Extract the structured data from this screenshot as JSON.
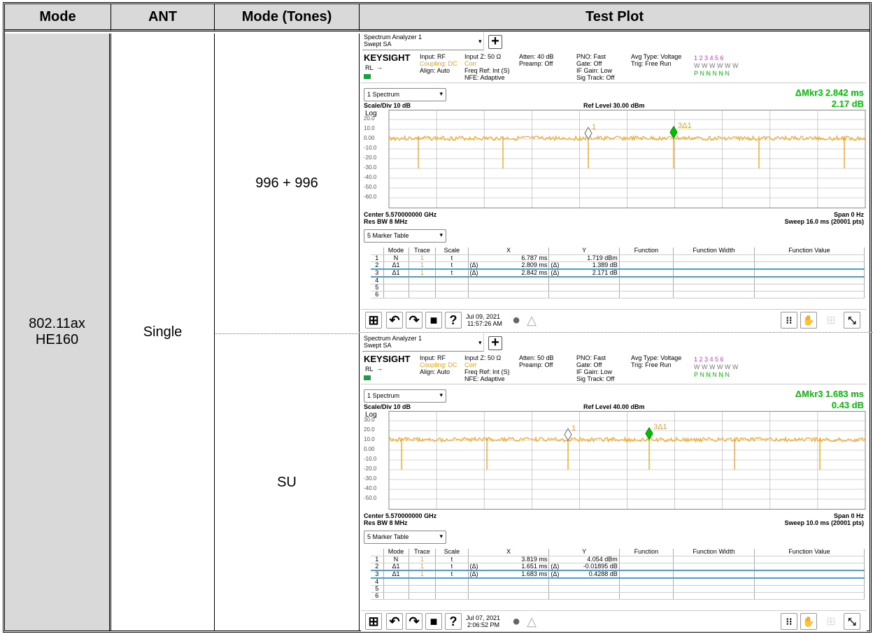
{
  "table": {
    "headers": [
      "Mode",
      "ANT",
      "Mode (Tones)",
      "Test Plot"
    ],
    "mode": "802.11ax HE160",
    "ant": "Single",
    "tones": [
      "996 + 996",
      "SU"
    ]
  },
  "plots": [
    {
      "title1": "Spectrum Analyzer 1",
      "title2": "Swept SA",
      "brand": "KEYSIGHT",
      "rl": "RL",
      "col1": [
        "Input: RF",
        "Coupling: DC",
        "Align: Auto"
      ],
      "col2": [
        "Input Z: 50 Ω",
        "Corr",
        "Freq Ref: Int (S)",
        "NFE: Adaptive"
      ],
      "col3": [
        "Atten: 40 dB",
        "Preamp: Off"
      ],
      "col4": [
        "PNO: Fast",
        "Gate: Off",
        "IF Gain: Low",
        "Sig Track: Off"
      ],
      "col5": [
        "Avg Type: Voltage",
        "Trig: Free Run"
      ],
      "trace_nums": "1 2 3 4 5 6",
      "trace_w": "W W W W W W",
      "trace_p": "P N N N N N",
      "view": "1 Spectrum",
      "mkr_label": "ΔMkr3  2.842 ms",
      "mkr_val": "2.17 dB",
      "scale": "Scale/Div 10 dB",
      "ref": "Ref Level 30.00 dBm",
      "log": "Log",
      "yticks": [
        "20.0",
        "10.0",
        "0.00",
        "-10.0",
        "-20.0",
        "-30.0",
        "-40.0",
        "-50.0",
        "-60.0"
      ],
      "center": "Center 5.570000000 GHz",
      "span": "Span 0 Hz",
      "rbw": "Res BW 8 MHz",
      "sweep": "Sweep 16.0 ms (20001 pts)",
      "marker_view": "5 Marker Table",
      "marker_headers": [
        "",
        "Mode",
        "Trace",
        "Scale",
        "X",
        "Y",
        "Function",
        "Function Width",
        "Function Value"
      ],
      "markers": [
        [
          "1",
          "N",
          "1",
          "t",
          "",
          "6.787 ms",
          "",
          "1.719 dBm"
        ],
        [
          "2",
          "Δ1",
          "1",
          "t",
          "(Δ)",
          "2.809 ms",
          "(Δ)",
          "1.389 dB"
        ],
        [
          "3",
          "Δ1",
          "1",
          "t",
          "(Δ)",
          "2.842 ms",
          "(Δ)",
          "2.171 dB"
        ],
        [
          "4",
          "",
          "",
          "",
          "",
          "",
          "",
          ""
        ],
        [
          "5",
          "",
          "",
          "",
          "",
          "",
          "",
          ""
        ],
        [
          "6",
          "",
          "",
          "",
          "",
          "",
          "",
          ""
        ]
      ],
      "mk1": "1",
      "mk3": "3Δ1",
      "date": "Jul 09, 2021",
      "time": "11:57:26 AM"
    },
    {
      "title1": "Spectrum Analyzer 1",
      "title2": "Swept SA",
      "brand": "KEYSIGHT",
      "rl": "RL",
      "col1": [
        "Input: RF",
        "Coupling: DC",
        "Align: Auto"
      ],
      "col2": [
        "Input Z: 50 Ω",
        "Corr",
        "Freq Ref: Int (S)",
        "NFE: Adaptive"
      ],
      "col3": [
        "Atten: 50 dB",
        "Preamp: Off"
      ],
      "col4": [
        "PNO: Fast",
        "Gate: Off",
        "IF Gain: Low",
        "Sig Track: Off"
      ],
      "col5": [
        "Avg Type: Voltage",
        "Trig: Free Run"
      ],
      "trace_nums": "1 2 3 4 5 6",
      "trace_w": "W W W W W W",
      "trace_p": "P N N N N N",
      "view": "1 Spectrum",
      "mkr_label": "ΔMkr3  1.683 ms",
      "mkr_val": "0.43 dB",
      "scale": "Scale/Div 10 dB",
      "ref": "Ref Level 40.00 dBm",
      "log": "Log",
      "yticks": [
        "30.0",
        "20.0",
        "10.0",
        "0.00",
        "-10.0",
        "-20.0",
        "-30.0",
        "-40.0",
        "-50.0"
      ],
      "center": "Center 5.570000000 GHz",
      "span": "Span 0 Hz",
      "rbw": "Res BW 8 MHz",
      "sweep": "Sweep 10.0 ms (20001 pts)",
      "marker_view": "5 Marker Table",
      "marker_headers": [
        "",
        "Mode",
        "Trace",
        "Scale",
        "X",
        "Y",
        "Function",
        "Function Width",
        "Function Value"
      ],
      "markers": [
        [
          "1",
          "N",
          "1",
          "t",
          "",
          "3.819 ms",
          "",
          "4.054 dBm"
        ],
        [
          "2",
          "Δ1",
          "1",
          "t",
          "(Δ)",
          "1.651 ms",
          "(Δ)",
          "-0.01895 dB"
        ],
        [
          "3",
          "Δ1",
          "1",
          "t",
          "(Δ)",
          "1.683 ms",
          "(Δ)",
          "0.4288 dB"
        ],
        [
          "4",
          "",
          "",
          "",
          "",
          "",
          "",
          ""
        ],
        [
          "5",
          "",
          "",
          "",
          "",
          "",
          "",
          ""
        ],
        [
          "6",
          "",
          "",
          "",
          "",
          "",
          "",
          ""
        ]
      ],
      "mk1": "1",
      "mk3": "3Δ1",
      "date": "Jul 07, 2021",
      "time": "2:06:52 PM"
    }
  ],
  "colors": {
    "trace": "#f5a623",
    "marker_green": "#00c000",
    "header_bg": "#d9d9d9",
    "selection": "#4aa0d8"
  },
  "icons": [
    "windows-icon",
    "undo-icon",
    "redo-icon",
    "folder-icon",
    "help-icon",
    "chat-icon",
    "warning-icon",
    "marker-icon",
    "touch-icon",
    "grid-icon",
    "fullscreen-icon"
  ]
}
